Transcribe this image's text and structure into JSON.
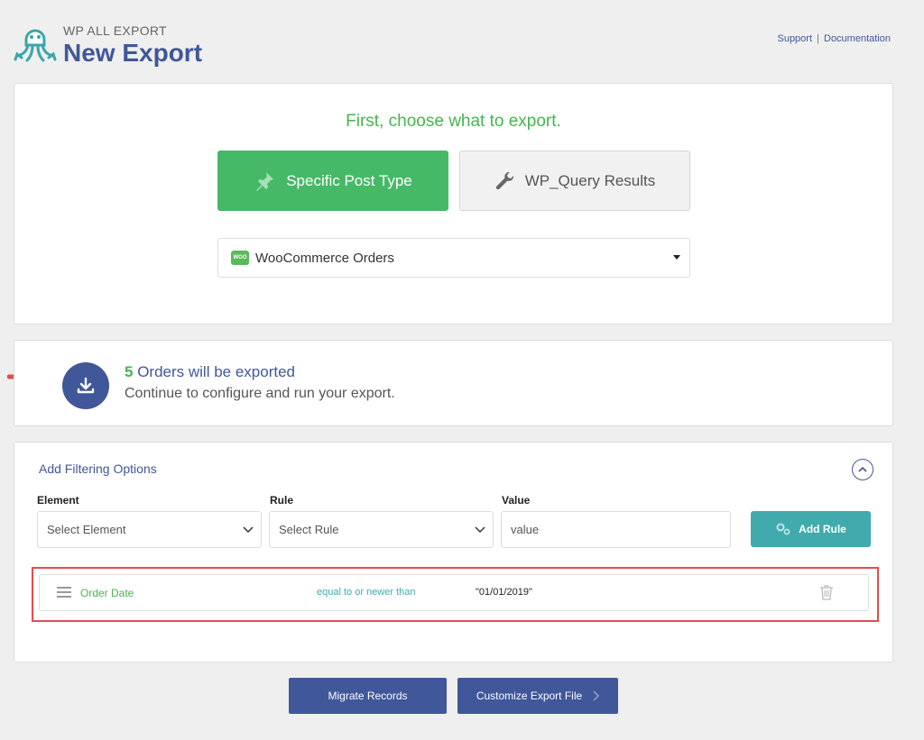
{
  "header": {
    "brand_small": "WP ALL EXPORT",
    "title": "New Export",
    "links": {
      "support": "Support",
      "separator": "|",
      "documentation": "Documentation"
    }
  },
  "choose": {
    "heading": "First, choose what to export.",
    "option_post_type": "Specific Post Type",
    "option_wp_query": "WP_Query Results",
    "selected_type": "WooCommerce Orders",
    "woo_badge": "WOO"
  },
  "export_count": {
    "count": "5",
    "line_rest": " Orders will be exported",
    "subtitle": "Continue to configure and run your export."
  },
  "filters": {
    "title": "Add Filtering Options",
    "element_label": "Element",
    "rule_label": "Rule",
    "value_label": "Value",
    "element_placeholder": "Select Element",
    "rule_placeholder": "Select Rule",
    "value_placeholder": "value",
    "add_rule_button": "Add Rule",
    "rule": {
      "element": "Order Date",
      "condition": "equal to or newer than",
      "value": "\"01/01/2019\""
    }
  },
  "footer": {
    "migrate_button": "Migrate Records",
    "customize_button": "Customize Export File"
  },
  "colors": {
    "brand_blue": "#40579a",
    "green": "#46b450",
    "teal": "#40aaad",
    "annotation_red": "#e24c4c"
  },
  "icons": [
    "octopus-logo-icon",
    "pin-icon",
    "wrench-icon",
    "download-icon",
    "chevron-up-icon",
    "chevron-down-icon",
    "gears-icon",
    "drag-handle-icon",
    "trash-icon",
    "chevron-right-icon",
    "red-arrow-icon"
  ]
}
